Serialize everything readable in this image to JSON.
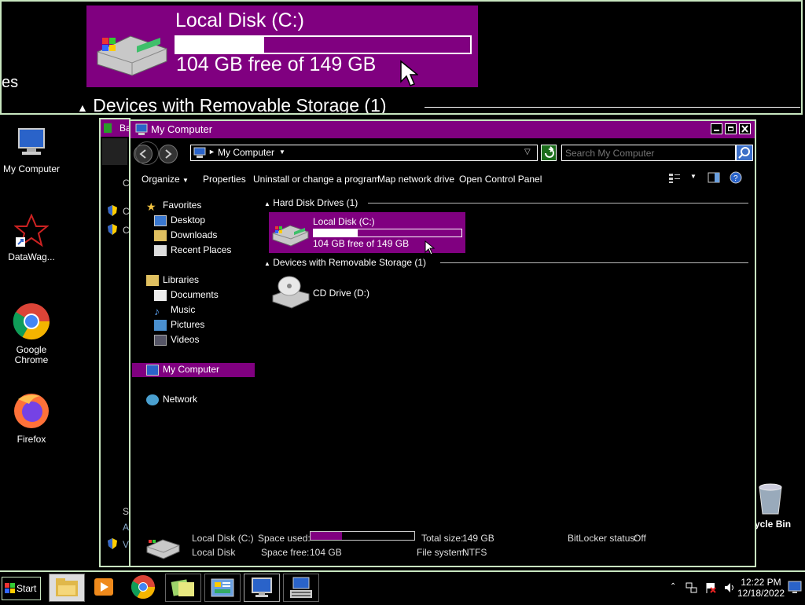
{
  "magnifier": {
    "drive_title": "Local Disk (C:)",
    "drive_free": "104 GB free of 149 GB",
    "partial_text": "es",
    "section_label": "Devices with Removable Storage (1)"
  },
  "desktop": {
    "icons": [
      {
        "label": "My Computer"
      },
      {
        "label": "DataWag..."
      },
      {
        "label": "Google Chrome"
      },
      {
        "label": "Firefox"
      },
      {
        "label": "ycle Bin"
      }
    ]
  },
  "background_window": {
    "title_partial": "Ba",
    "row_chars": [
      "C",
      "C"
    ],
    "bottom_chars": [
      "S",
      "A",
      "V"
    ]
  },
  "explorer": {
    "title": "My Computer",
    "address": "My Computer",
    "search_placeholder": "Search My Computer",
    "toolbar": {
      "organize": "Organize",
      "properties": "Properties",
      "uninstall": "Uninstall or change a program",
      "map_drive": "Map network drive",
      "control_panel": "Open Control Panel"
    },
    "nav": {
      "favorites": "Favorites",
      "desktop": "Desktop",
      "downloads": "Downloads",
      "recent": "Recent Places",
      "libraries": "Libraries",
      "documents": "Documents",
      "music": "Music",
      "pictures": "Pictures",
      "videos": "Videos",
      "my_computer": "My Computer",
      "network": "Network"
    },
    "groups": {
      "hdd": "Hard Disk Drives (1)",
      "removable": "Devices with Removable Storage (1)"
    },
    "drive_c": {
      "name": "Local Disk (C:)",
      "free": "104 GB free of 149 GB",
      "used_fraction": 0.3
    },
    "drive_d": {
      "name": "CD Drive (D:)"
    },
    "details": {
      "name": "Local Disk (C:)",
      "type": "Local Disk",
      "space_used_label": "Space used:",
      "space_free_label": "Space free:",
      "space_free": "104 GB",
      "total_size_label": "Total size:",
      "total_size": "149 GB",
      "fs_label": "File system:",
      "fs": "NTFS",
      "bitlocker_label": "BitLocker status:",
      "bitlocker": "Off"
    }
  },
  "taskbar": {
    "start": "Start",
    "time": "12:22 PM",
    "date": "12/18/2022"
  },
  "colors": {
    "accent": "#800080",
    "border": "#c8e6c0",
    "background": "#000000"
  }
}
